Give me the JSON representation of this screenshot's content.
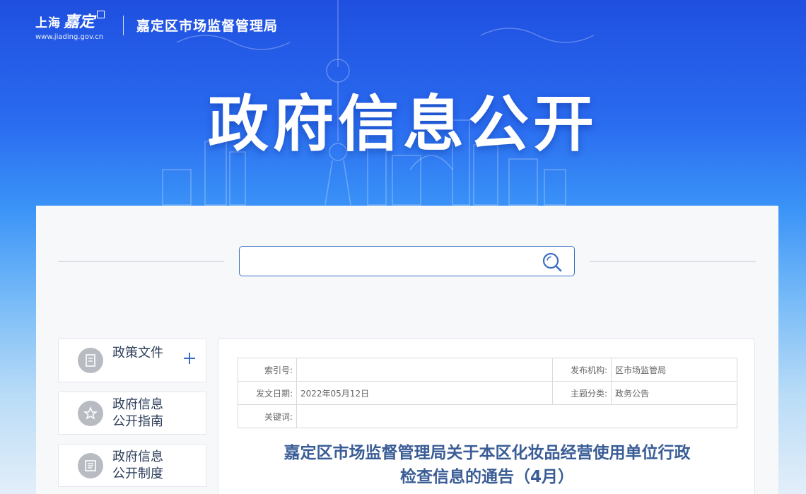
{
  "header": {
    "logo_city": "上海",
    "logo_district": "嘉定",
    "logo_url": "www.jiading.gov.cn",
    "title": "嘉定区市场监督管理局"
  },
  "hero": {
    "title": "政府信息公开"
  },
  "search": {
    "placeholder": "",
    "value": ""
  },
  "sidebar": {
    "items": [
      {
        "label": "政策文件",
        "icon": "document-icon",
        "expandable": true
      },
      {
        "label": "政府信息\n公开指南",
        "icon": "guide-icon"
      },
      {
        "label": "政府信息\n公开制度",
        "icon": "rules-icon"
      }
    ]
  },
  "meta": {
    "index_label": "索引号:",
    "index_value": "",
    "publisher_label": "发布机构:",
    "publisher_value": "区市场监管局",
    "date_label": "发文日期:",
    "date_value": "2022年05月12日",
    "topic_label": "主题分类:",
    "topic_value": "政务公告",
    "keywords_label": "关键词:",
    "keywords_value": ""
  },
  "document": {
    "title_line1": "嘉定区市场监督管理局关于本区化妆品经营使用单位行政",
    "title_line2": "检查信息的通告（4月）"
  },
  "colors": {
    "brand_blue": "#2a6cf0",
    "title_blue": "#3a5d96",
    "search_border": "#3b6fc4"
  }
}
